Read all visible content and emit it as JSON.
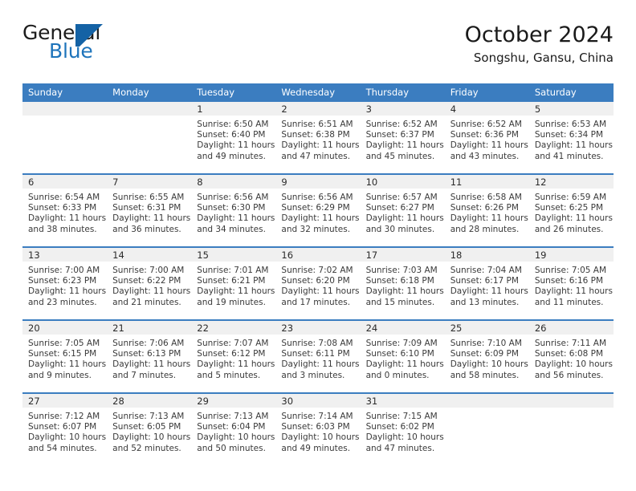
{
  "brand": {
    "name_part1": "General",
    "name_part2": "Blue",
    "mark": "triangle-logo"
  },
  "header": {
    "title": "October 2024",
    "subtitle": "Songshu, Gansu, China"
  },
  "colors": {
    "header_blue": "#3b7dc0",
    "row_divider_blue": "#3b7dc0",
    "daynum_band": "#f0f0f0",
    "brand_blue": "#1e74bb",
    "text": "#3a3a3a"
  },
  "weekday_headers": [
    "Sunday",
    "Monday",
    "Tuesday",
    "Wednesday",
    "Thursday",
    "Friday",
    "Saturday"
  ],
  "weeks": [
    [
      {
        "day": "",
        "empty": true
      },
      {
        "day": "",
        "empty": true
      },
      {
        "day": "1",
        "sunrise": "Sunrise: 6:50 AM",
        "sunset": "Sunset: 6:40 PM",
        "daylight_l1": "Daylight: 11 hours",
        "daylight_l2": "and 49 minutes."
      },
      {
        "day": "2",
        "sunrise": "Sunrise: 6:51 AM",
        "sunset": "Sunset: 6:38 PM",
        "daylight_l1": "Daylight: 11 hours",
        "daylight_l2": "and 47 minutes."
      },
      {
        "day": "3",
        "sunrise": "Sunrise: 6:52 AM",
        "sunset": "Sunset: 6:37 PM",
        "daylight_l1": "Daylight: 11 hours",
        "daylight_l2": "and 45 minutes."
      },
      {
        "day": "4",
        "sunrise": "Sunrise: 6:52 AM",
        "sunset": "Sunset: 6:36 PM",
        "daylight_l1": "Daylight: 11 hours",
        "daylight_l2": "and 43 minutes."
      },
      {
        "day": "5",
        "sunrise": "Sunrise: 6:53 AM",
        "sunset": "Sunset: 6:34 PM",
        "daylight_l1": "Daylight: 11 hours",
        "daylight_l2": "and 41 minutes."
      }
    ],
    [
      {
        "day": "6",
        "sunrise": "Sunrise: 6:54 AM",
        "sunset": "Sunset: 6:33 PM",
        "daylight_l1": "Daylight: 11 hours",
        "daylight_l2": "and 38 minutes."
      },
      {
        "day": "7",
        "sunrise": "Sunrise: 6:55 AM",
        "sunset": "Sunset: 6:31 PM",
        "daylight_l1": "Daylight: 11 hours",
        "daylight_l2": "and 36 minutes."
      },
      {
        "day": "8",
        "sunrise": "Sunrise: 6:56 AM",
        "sunset": "Sunset: 6:30 PM",
        "daylight_l1": "Daylight: 11 hours",
        "daylight_l2": "and 34 minutes."
      },
      {
        "day": "9",
        "sunrise": "Sunrise: 6:56 AM",
        "sunset": "Sunset: 6:29 PM",
        "daylight_l1": "Daylight: 11 hours",
        "daylight_l2": "and 32 minutes."
      },
      {
        "day": "10",
        "sunrise": "Sunrise: 6:57 AM",
        "sunset": "Sunset: 6:27 PM",
        "daylight_l1": "Daylight: 11 hours",
        "daylight_l2": "and 30 minutes."
      },
      {
        "day": "11",
        "sunrise": "Sunrise: 6:58 AM",
        "sunset": "Sunset: 6:26 PM",
        "daylight_l1": "Daylight: 11 hours",
        "daylight_l2": "and 28 minutes."
      },
      {
        "day": "12",
        "sunrise": "Sunrise: 6:59 AM",
        "sunset": "Sunset: 6:25 PM",
        "daylight_l1": "Daylight: 11 hours",
        "daylight_l2": "and 26 minutes."
      }
    ],
    [
      {
        "day": "13",
        "sunrise": "Sunrise: 7:00 AM",
        "sunset": "Sunset: 6:23 PM",
        "daylight_l1": "Daylight: 11 hours",
        "daylight_l2": "and 23 minutes."
      },
      {
        "day": "14",
        "sunrise": "Sunrise: 7:00 AM",
        "sunset": "Sunset: 6:22 PM",
        "daylight_l1": "Daylight: 11 hours",
        "daylight_l2": "and 21 minutes."
      },
      {
        "day": "15",
        "sunrise": "Sunrise: 7:01 AM",
        "sunset": "Sunset: 6:21 PM",
        "daylight_l1": "Daylight: 11 hours",
        "daylight_l2": "and 19 minutes."
      },
      {
        "day": "16",
        "sunrise": "Sunrise: 7:02 AM",
        "sunset": "Sunset: 6:20 PM",
        "daylight_l1": "Daylight: 11 hours",
        "daylight_l2": "and 17 minutes."
      },
      {
        "day": "17",
        "sunrise": "Sunrise: 7:03 AM",
        "sunset": "Sunset: 6:18 PM",
        "daylight_l1": "Daylight: 11 hours",
        "daylight_l2": "and 15 minutes."
      },
      {
        "day": "18",
        "sunrise": "Sunrise: 7:04 AM",
        "sunset": "Sunset: 6:17 PM",
        "daylight_l1": "Daylight: 11 hours",
        "daylight_l2": "and 13 minutes."
      },
      {
        "day": "19",
        "sunrise": "Sunrise: 7:05 AM",
        "sunset": "Sunset: 6:16 PM",
        "daylight_l1": "Daylight: 11 hours",
        "daylight_l2": "and 11 minutes."
      }
    ],
    [
      {
        "day": "20",
        "sunrise": "Sunrise: 7:05 AM",
        "sunset": "Sunset: 6:15 PM",
        "daylight_l1": "Daylight: 11 hours",
        "daylight_l2": "and 9 minutes."
      },
      {
        "day": "21",
        "sunrise": "Sunrise: 7:06 AM",
        "sunset": "Sunset: 6:13 PM",
        "daylight_l1": "Daylight: 11 hours",
        "daylight_l2": "and 7 minutes."
      },
      {
        "day": "22",
        "sunrise": "Sunrise: 7:07 AM",
        "sunset": "Sunset: 6:12 PM",
        "daylight_l1": "Daylight: 11 hours",
        "daylight_l2": "and 5 minutes."
      },
      {
        "day": "23",
        "sunrise": "Sunrise: 7:08 AM",
        "sunset": "Sunset: 6:11 PM",
        "daylight_l1": "Daylight: 11 hours",
        "daylight_l2": "and 3 minutes."
      },
      {
        "day": "24",
        "sunrise": "Sunrise: 7:09 AM",
        "sunset": "Sunset: 6:10 PM",
        "daylight_l1": "Daylight: 11 hours",
        "daylight_l2": "and 0 minutes."
      },
      {
        "day": "25",
        "sunrise": "Sunrise: 7:10 AM",
        "sunset": "Sunset: 6:09 PM",
        "daylight_l1": "Daylight: 10 hours",
        "daylight_l2": "and 58 minutes."
      },
      {
        "day": "26",
        "sunrise": "Sunrise: 7:11 AM",
        "sunset": "Sunset: 6:08 PM",
        "daylight_l1": "Daylight: 10 hours",
        "daylight_l2": "and 56 minutes."
      }
    ],
    [
      {
        "day": "27",
        "sunrise": "Sunrise: 7:12 AM",
        "sunset": "Sunset: 6:07 PM",
        "daylight_l1": "Daylight: 10 hours",
        "daylight_l2": "and 54 minutes."
      },
      {
        "day": "28",
        "sunrise": "Sunrise: 7:13 AM",
        "sunset": "Sunset: 6:05 PM",
        "daylight_l1": "Daylight: 10 hours",
        "daylight_l2": "and 52 minutes."
      },
      {
        "day": "29",
        "sunrise": "Sunrise: 7:13 AM",
        "sunset": "Sunset: 6:04 PM",
        "daylight_l1": "Daylight: 10 hours",
        "daylight_l2": "and 50 minutes."
      },
      {
        "day": "30",
        "sunrise": "Sunrise: 7:14 AM",
        "sunset": "Sunset: 6:03 PM",
        "daylight_l1": "Daylight: 10 hours",
        "daylight_l2": "and 49 minutes."
      },
      {
        "day": "31",
        "sunrise": "Sunrise: 7:15 AM",
        "sunset": "Sunset: 6:02 PM",
        "daylight_l1": "Daylight: 10 hours",
        "daylight_l2": "and 47 minutes."
      },
      {
        "day": "",
        "empty": true
      },
      {
        "day": "",
        "empty": true
      }
    ]
  ]
}
